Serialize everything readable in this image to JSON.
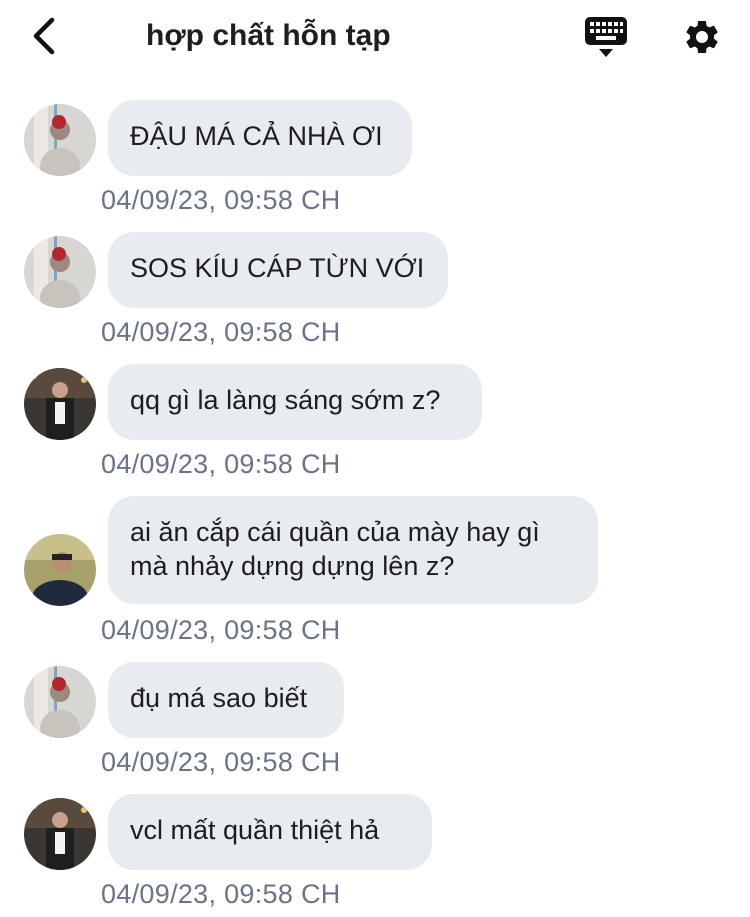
{
  "header": {
    "title": "hợp chất hỗn tạp",
    "back_icon": "chevron-left-icon",
    "keyboard_icon": "keyboard-icon",
    "settings_icon": "gear-icon"
  },
  "colors": {
    "bubble": "#e8ebf0",
    "timestamp": "#6a7486",
    "text": "#1c1e21"
  },
  "messages": [
    {
      "sender_avatar": "avatar-user-a",
      "lines": [
        "ĐẬU MÁ CẢ NHÀ ƠI"
      ],
      "timestamp": "04/09/23, 09:58 CH"
    },
    {
      "sender_avatar": "avatar-user-a",
      "lines": [
        "SOS KÍU CÁP TỪN VỚI"
      ],
      "timestamp": "04/09/23, 09:58 CH"
    },
    {
      "sender_avatar": "avatar-user-b",
      "lines": [
        "qq gì la làng sáng sớm z?"
      ],
      "timestamp": "04/09/23, 09:58 CH"
    },
    {
      "sender_avatar": "avatar-user-c",
      "lines": [
        "ai ăn cắp cái quần của mày hay gì",
        "mà nhảy dựng dựng lên z?"
      ],
      "timestamp": "04/09/23, 09:58 CH"
    },
    {
      "sender_avatar": "avatar-user-a",
      "lines": [
        "đụ má sao biết"
      ],
      "timestamp": "04/09/23, 09:58 CH"
    },
    {
      "sender_avatar": "avatar-user-b",
      "lines": [
        "vcl mất quần thiệt hả"
      ],
      "timestamp": "04/09/23, 09:58 CH"
    }
  ]
}
